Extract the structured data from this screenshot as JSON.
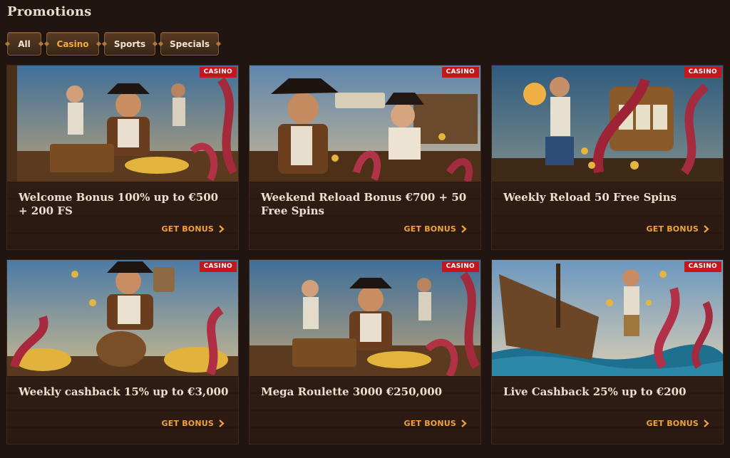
{
  "header": {
    "title": "Promotions"
  },
  "filters": [
    {
      "label": "All",
      "active": false
    },
    {
      "label": "Casino",
      "active": true
    },
    {
      "label": "Sports",
      "active": false
    },
    {
      "label": "Specials",
      "active": false
    }
  ],
  "promotions": [
    {
      "badge": "CASINO",
      "title": "Welcome Bonus 100% up to €500 + 200 FS",
      "cta": "GET BONUS",
      "image": "pirate-captain-treasure-illustration"
    },
    {
      "badge": "CASINO",
      "title": "Weekend Reload Bonus €700 + 50 Free Spins",
      "cta": "GET BONUS",
      "image": "pirate-duo-ship-deck-illustration"
    },
    {
      "badge": "CASINO",
      "title": "Weekly Reload 50 Free Spins",
      "cta": "GET BONUS",
      "image": "pirate-slot-machine-illustration"
    },
    {
      "badge": "CASINO",
      "title": "Weekly cashback 15% up to €3,000",
      "cta": "GET BONUS",
      "image": "pirate-barrel-gold-illustration"
    },
    {
      "badge": "CASINO",
      "title": "Mega Roulette 3000 €250,000",
      "cta": "GET BONUS",
      "image": "pirate-captain-treasure-illustration"
    },
    {
      "badge": "CASINO",
      "title": "Live Cashback 25% up to €200",
      "cta": "GET BONUS",
      "image": "pirate-shipwreck-kraken-illustration"
    }
  ],
  "colors": {
    "page_bg": "#211512",
    "card_bg": "#2b1b14",
    "accent": "#f0a33a",
    "badge": "#c4161c",
    "title_text": "#ebdfcc"
  }
}
